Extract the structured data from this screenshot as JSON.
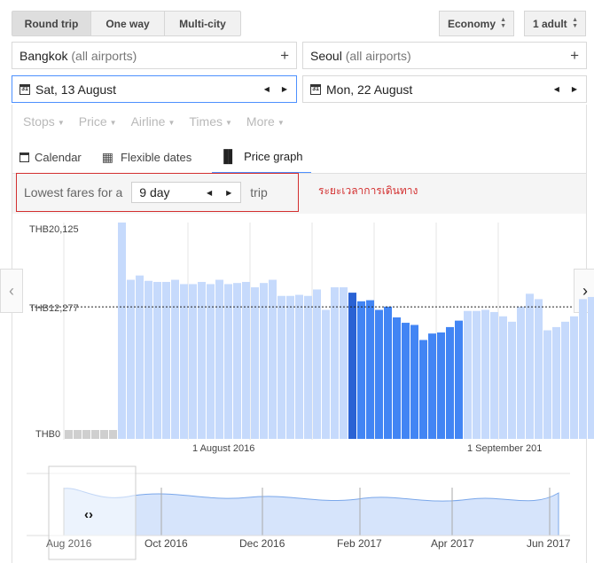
{
  "trip_type": {
    "round_trip": "Round trip",
    "one_way": "One way",
    "multi_city": "Multi-city"
  },
  "cabin": {
    "value": "Economy"
  },
  "passengers": {
    "value": "1 adult"
  },
  "origin": {
    "city": "Bangkok",
    "qualifier": "(all airports)"
  },
  "destination": {
    "city": "Seoul",
    "qualifier": "(all airports)"
  },
  "depart": {
    "value": "Sat, 13 August",
    "icon_text": "31"
  },
  "return": {
    "value": "Mon, 22 August",
    "icon_text": "31"
  },
  "filters": [
    "Stops",
    "Price",
    "Airline",
    "Times",
    "More"
  ],
  "views": {
    "calendar": "Calendar",
    "flexible": "Flexible dates",
    "price_graph": "Price graph"
  },
  "lowest_fares": {
    "prefix": "Lowest fares for a",
    "value": "9 day",
    "suffix": "trip"
  },
  "annotation": "ระยะเวลาการเดินทาง",
  "chart_data": {
    "type": "bar",
    "y_ticks": [
      "THB20,125",
      "THB12,277",
      "THB0"
    ],
    "reference_line": {
      "label": "THB12,277",
      "value": 12277
    },
    "ylim": [
      0,
      20125
    ],
    "x_labels": [
      "1 August 2016",
      "1 September 201"
    ],
    "first_day": "2016-07-06",
    "unavailable_days": 6,
    "values": [
      20125,
      14800,
      15200,
      14700,
      14600,
      14600,
      14800,
      14400,
      14400,
      14600,
      14400,
      14800,
      14400,
      14500,
      14600,
      14100,
      14500,
      14800,
      13300,
      13300,
      13400,
      13300,
      13900,
      12000,
      14100,
      14100,
      13600,
      12800,
      12900,
      12000,
      12300,
      11300,
      10800,
      10600,
      9200,
      9800,
      9900,
      10400,
      11000,
      11900,
      11900,
      12000,
      11800,
      11400,
      10900,
      12300,
      13500,
      13000,
      10100,
      10400,
      10900,
      11400,
      13000,
      13200,
      11600,
      9700,
      9800,
      10400,
      8800
    ],
    "selected_range": [
      26,
      38
    ],
    "selected_day": 26
  },
  "overview": {
    "x_labels": [
      "Aug 2016",
      "Oct 2016",
      "Dec 2016",
      "Feb 2017",
      "Apr 2017",
      "Jun 2017"
    ],
    "handle_icon": "expand-icon"
  },
  "nav": {
    "prev_icon": "chevron-left-icon",
    "next_icon": "chevron-right-icon"
  },
  "colors": {
    "bar": "#c6dafc",
    "bar_selected": "#4285f4",
    "bar_selected_day": "#2a62d4",
    "accent": "#4d90fe",
    "annotation": "#d32f2f"
  }
}
